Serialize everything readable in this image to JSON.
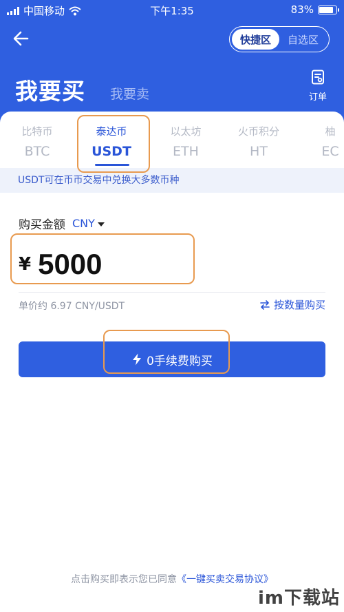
{
  "status_bar": {
    "carrier": "中国移动",
    "time": "下午1:35",
    "battery_pct": "83%",
    "battery_level": 0.83
  },
  "header": {
    "segment": {
      "items": [
        "快捷区",
        "自选区"
      ],
      "active": "快捷区"
    },
    "title_buy": "我要买",
    "title_sell": "我要卖",
    "orders_label": "订单"
  },
  "coin_tabs": [
    {
      "cn": "比特币",
      "en": "BTC"
    },
    {
      "cn": "泰达币",
      "en": "USDT",
      "active": true
    },
    {
      "cn": "以太坊",
      "en": "ETH"
    },
    {
      "cn": "火币积分",
      "en": "HT"
    },
    {
      "cn": "柚",
      "en": "EC"
    }
  ],
  "notice": "USDT可在币币交易中兑换大多数币种",
  "purchase": {
    "amount_label": "购买金额",
    "currency": "CNY",
    "currency_symbol": "¥",
    "amount": "5000",
    "unit_price": "单价约 6.97 CNY/USDT",
    "by_quantity_label": "按数量购买",
    "buy_button_label": "0手续费购买"
  },
  "agreement": {
    "prefix": "点击购买即表示您已同意",
    "link": "《一键买卖交易协议》"
  },
  "watermark": "im下载站",
  "colors": {
    "primary": "#2f5fe0",
    "accent_text": "#2a55d8",
    "highlight_outline": "#e89a4f"
  }
}
